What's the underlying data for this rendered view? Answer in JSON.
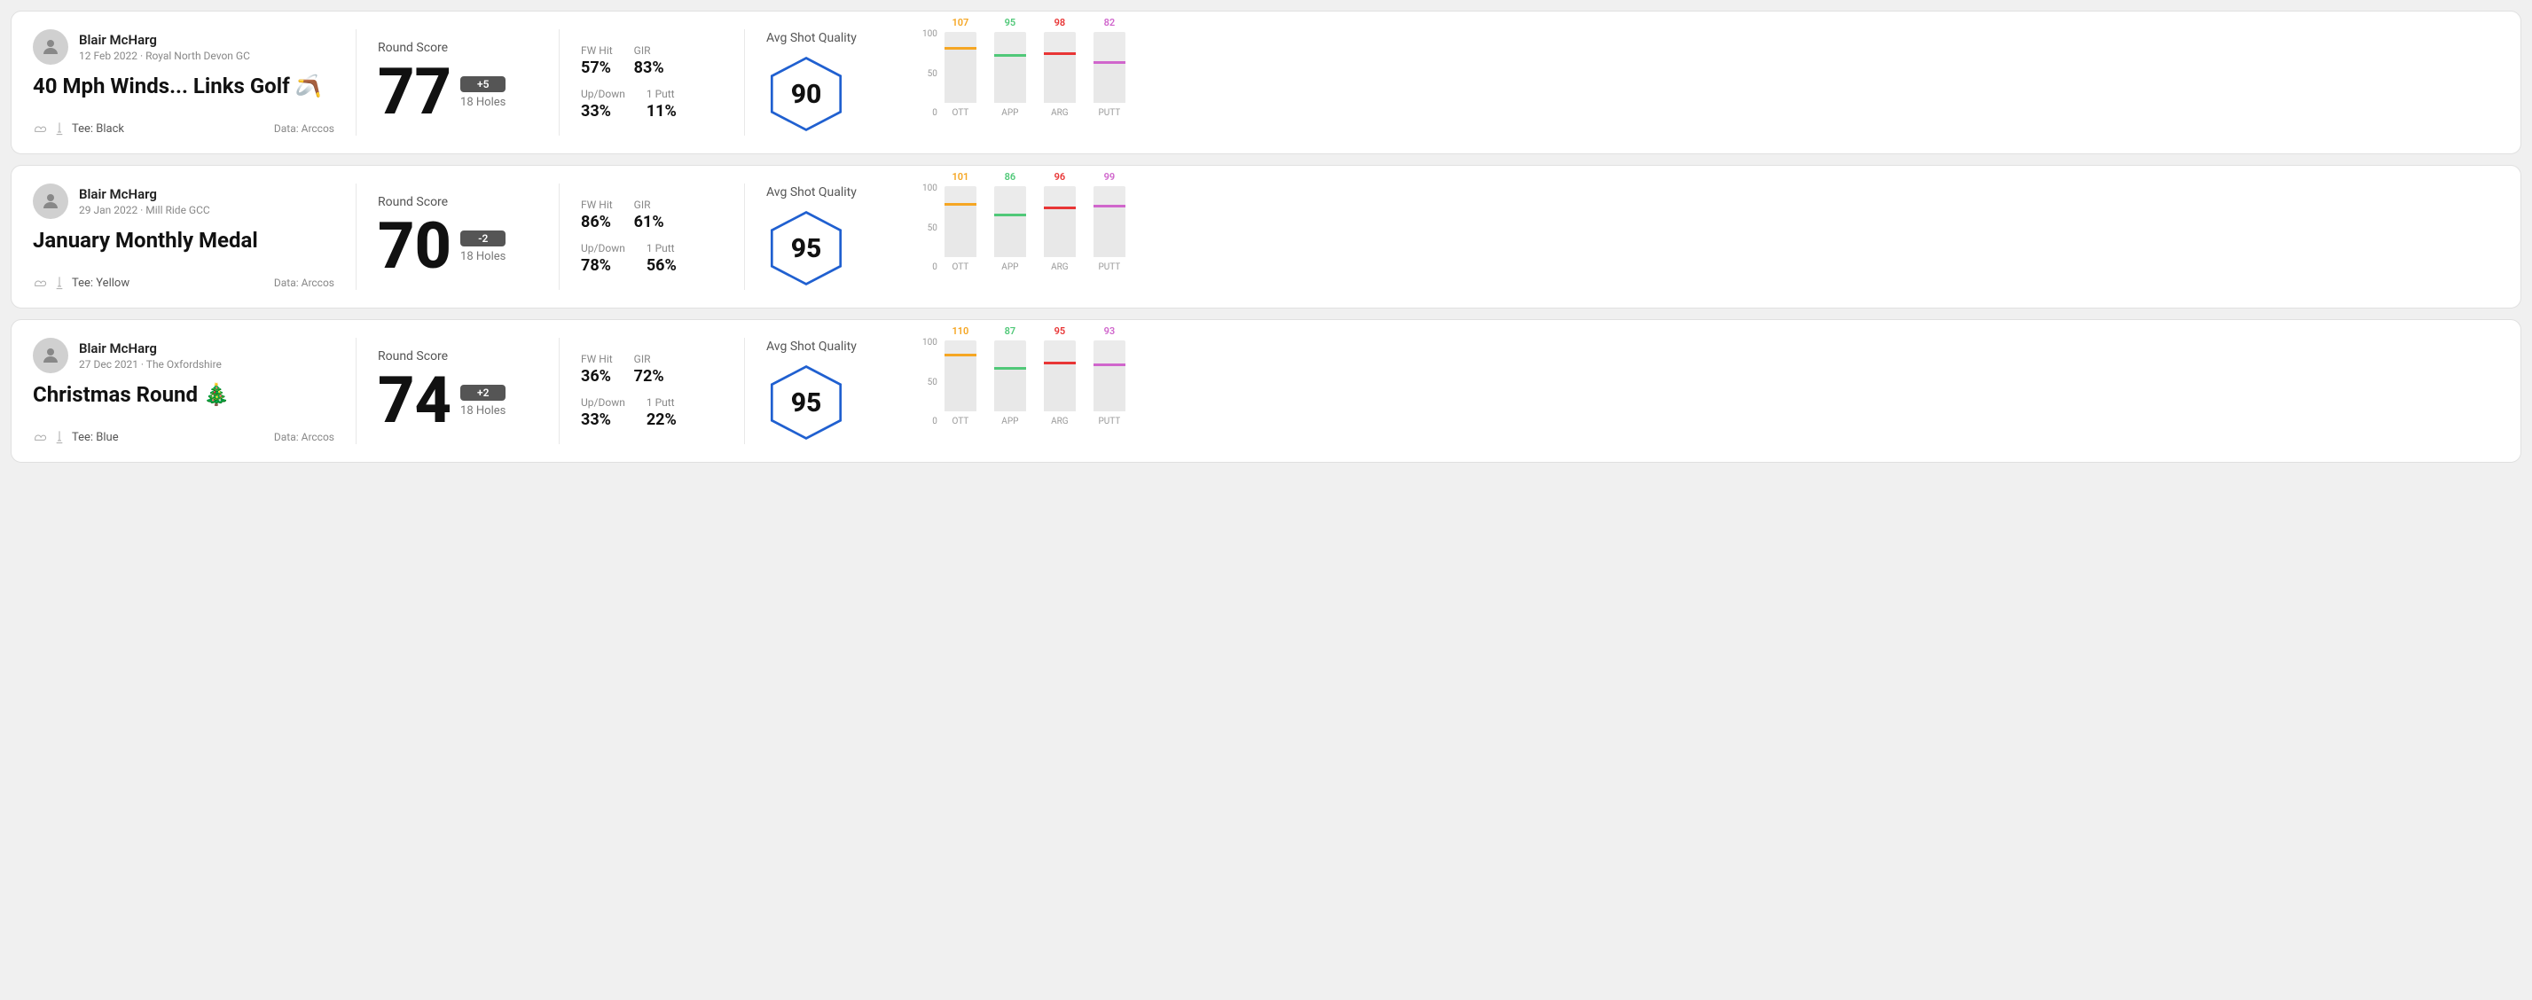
{
  "cards": [
    {
      "id": "card1",
      "user": {
        "name": "Blair McHarg",
        "date": "12 Feb 2022 · Royal North Devon GC"
      },
      "title": "40 Mph Winds... Links Golf 🪃",
      "tee": "Tee: Black",
      "data_source": "Data: Arccos",
      "round_score_label": "Round Score",
      "score": "77",
      "badge": "+5",
      "holes": "18 Holes",
      "fw_hit_label": "FW Hit",
      "fw_hit": "57%",
      "gir_label": "GIR",
      "gir": "83%",
      "updown_label": "Up/Down",
      "updown": "33%",
      "oneputt_label": "1 Putt",
      "oneputt": "11%",
      "quality_label": "Avg Shot Quality",
      "quality_score": "90",
      "chart": {
        "bars": [
          {
            "label": "OTT",
            "value": 107,
            "color": "#f5a623",
            "pct": 75
          },
          {
            "label": "APP",
            "value": 95,
            "color": "#50c878",
            "pct": 65
          },
          {
            "label": "ARG",
            "value": 98,
            "color": "#e83535",
            "pct": 68
          },
          {
            "label": "PUTT",
            "value": 82,
            "color": "#d066cc",
            "pct": 55
          }
        ]
      }
    },
    {
      "id": "card2",
      "user": {
        "name": "Blair McHarg",
        "date": "29 Jan 2022 · Mill Ride GCC"
      },
      "title": "January Monthly Medal",
      "tee": "Tee: Yellow",
      "data_source": "Data: Arccos",
      "round_score_label": "Round Score",
      "score": "70",
      "badge": "-2",
      "holes": "18 Holes",
      "fw_hit_label": "FW Hit",
      "fw_hit": "86%",
      "gir_label": "GIR",
      "gir": "61%",
      "updown_label": "Up/Down",
      "updown": "78%",
      "oneputt_label": "1 Putt",
      "oneputt": "56%",
      "quality_label": "Avg Shot Quality",
      "quality_score": "95",
      "chart": {
        "bars": [
          {
            "label": "OTT",
            "value": 101,
            "color": "#f5a623",
            "pct": 72
          },
          {
            "label": "APP",
            "value": 86,
            "color": "#50c878",
            "pct": 58
          },
          {
            "label": "ARG",
            "value": 96,
            "color": "#e83535",
            "pct": 67
          },
          {
            "label": "PUTT",
            "value": 99,
            "color": "#d066cc",
            "pct": 70
          }
        ]
      }
    },
    {
      "id": "card3",
      "user": {
        "name": "Blair McHarg",
        "date": "27 Dec 2021 · The Oxfordshire"
      },
      "title": "Christmas Round 🎄",
      "tee": "Tee: Blue",
      "data_source": "Data: Arccos",
      "round_score_label": "Round Score",
      "score": "74",
      "badge": "+2",
      "holes": "18 Holes",
      "fw_hit_label": "FW Hit",
      "fw_hit": "36%",
      "gir_label": "GIR",
      "gir": "72%",
      "updown_label": "Up/Down",
      "updown": "33%",
      "oneputt_label": "1 Putt",
      "oneputt": "22%",
      "quality_label": "Avg Shot Quality",
      "quality_score": "95",
      "chart": {
        "bars": [
          {
            "label": "OTT",
            "value": 110,
            "color": "#f5a623",
            "pct": 78
          },
          {
            "label": "APP",
            "value": 87,
            "color": "#50c878",
            "pct": 59
          },
          {
            "label": "ARG",
            "value": 95,
            "color": "#e83535",
            "pct": 66
          },
          {
            "label": "PUTT",
            "value": 93,
            "color": "#d066cc",
            "pct": 64
          }
        ]
      }
    }
  ],
  "chart_y_labels": [
    "100",
    "50",
    "0"
  ]
}
